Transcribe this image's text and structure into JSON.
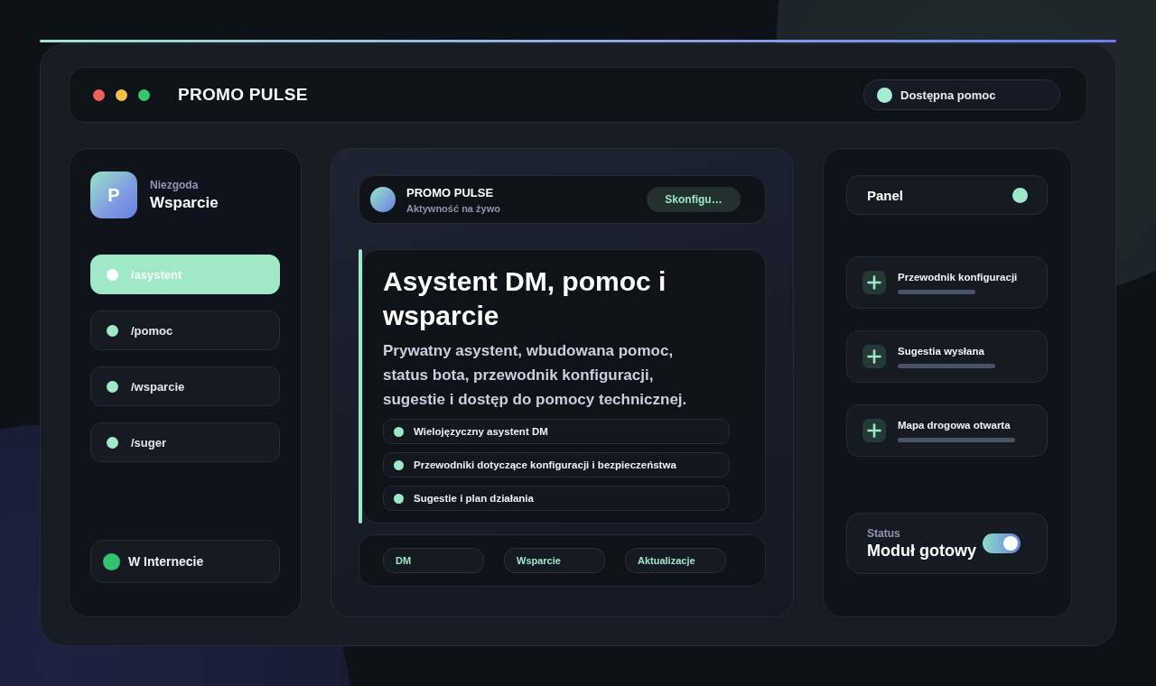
{
  "header": {
    "title": "PROMO PULSE",
    "status": {
      "label": "Dostępna pomoc"
    }
  },
  "sidebar": {
    "brand": {
      "initial": "P",
      "subtitle": "Niezgoda",
      "title": "Wsparcie"
    },
    "items": [
      {
        "label": "/asystent",
        "selected": true
      },
      {
        "label": "/pomoc",
        "selected": false
      },
      {
        "label": "/wsparcie",
        "selected": false
      },
      {
        "label": "/suger",
        "selected": false
      }
    ],
    "status": {
      "label": "W Internecie",
      "online": true
    }
  },
  "main": {
    "bot": {
      "name": "PROMO PULSE",
      "activity": "Aktywność na żywo",
      "button": "Skonfigu…"
    },
    "hero": {
      "title": "Asystent DM, pomoc i wsparcie",
      "description": "Prywatny asystent, wbudowana pomoc, status bota, przewodnik konfiguracji, sugestie i dostęp do pomocy technicznej.",
      "features": [
        "Wielojęzyczny asystent DM",
        "Przewodniki dotyczące konfiguracji i bezpieczeństwa",
        "Sugestie i plan działania"
      ]
    },
    "tags": [
      "DM",
      "Wsparcie",
      "Aktualizacje"
    ]
  },
  "right": {
    "panel": {
      "title": "Panel"
    },
    "items": [
      "Przewodnik konfiguracji",
      "Sugestia wysłana",
      "Mapa drogowa otwarta"
    ],
    "status": {
      "label": "Status",
      "value": "Moduł gotowy",
      "on": true
    }
  }
}
